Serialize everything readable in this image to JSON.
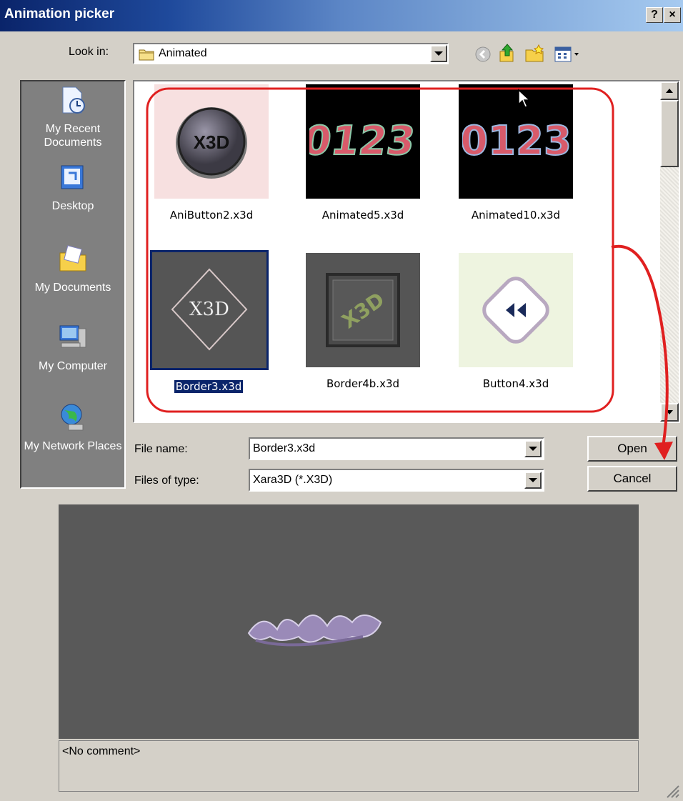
{
  "window": {
    "title": "Animation picker",
    "help": "?",
    "close": "×"
  },
  "toolbar": {
    "look_in_label": "Look in:",
    "look_in_value": "Animated"
  },
  "places": [
    {
      "label": "My Recent Documents"
    },
    {
      "label": "Desktop"
    },
    {
      "label": "My Documents"
    },
    {
      "label": "My Computer"
    },
    {
      "label": "My Network Places"
    }
  ],
  "files": [
    {
      "name": "AniButton2.x3d",
      "thumb_text": "X3D"
    },
    {
      "name": "Animated5.x3d",
      "thumb_text": "0123"
    },
    {
      "name": "Animated10.x3d",
      "thumb_text": "0123"
    },
    {
      "name": "Border3.x3d",
      "thumb_text": "X3D",
      "selected": true
    },
    {
      "name": "Border4b.x3d",
      "thumb_text": "X3D"
    },
    {
      "name": "Button4.x3d",
      "thumb_text": ""
    }
  ],
  "form": {
    "file_name_label": "File name:",
    "file_name_value": "Border3.x3d",
    "file_type_label": "Files of type:",
    "file_type_value": "Xara3D (*.X3D)",
    "open_label": "Open",
    "cancel_label": "Cancel"
  },
  "preview": {
    "comment": "<No comment>"
  },
  "colors": {
    "accent": "#0a246a",
    "annotation": "#e02020",
    "preview_bg": "#595959"
  }
}
